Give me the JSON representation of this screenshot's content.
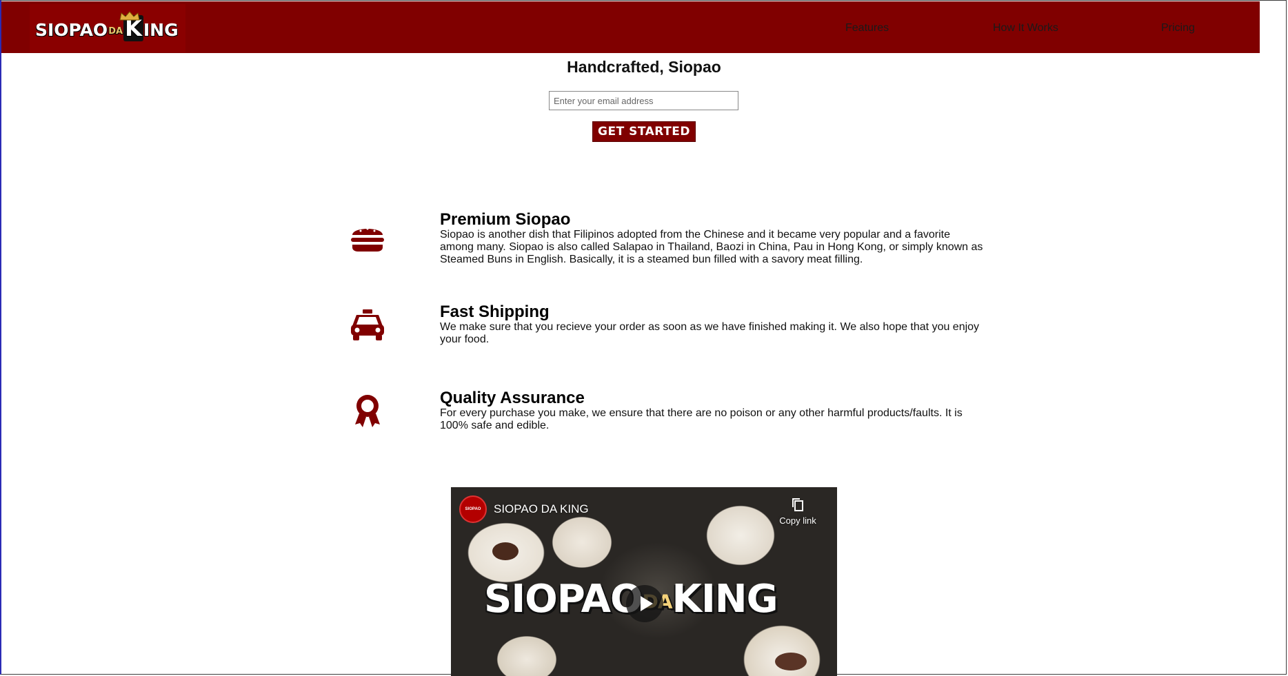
{
  "brand": {
    "logo_main": "SIOPAO",
    "logo_da": "DA",
    "logo_k": "K",
    "logo_end": "ING",
    "primary_color": "#800000"
  },
  "nav": {
    "links": [
      "Features",
      "How It Works",
      "Pricing"
    ]
  },
  "hero": {
    "title": "Handcrafted, Siopao",
    "email_placeholder": "Enter your email address",
    "cta_label": "GET STARTED"
  },
  "features": [
    {
      "icon": "hamburger-icon",
      "title": "Premium Siopao",
      "text": "Siopao is another dish that Filipinos adopted from the Chinese and it became very popular and a favorite among many. Siopao is also called Salapao in Thailand, Baozi in China, Pau in Hong Kong, or simply known as Steamed Buns in English. Basically, it is a steamed bun filled with a savory meat filling."
    },
    {
      "icon": "taxi-icon",
      "title": "Fast Shipping",
      "text": "We make sure that you recieve your order as soon as we have finished making it. We also hope that you enjoy your food."
    },
    {
      "icon": "award-ribbon-icon",
      "title": "Quality Assurance",
      "text": "For every purchase you make, we ensure that there are no poison or any other harmful products/faults. It is 100% safe and edible."
    }
  ],
  "video": {
    "channel_title": "SIOPAO DA KING",
    "copy_link_label": "Copy link",
    "wordmark_main": "SIOPAO",
    "wordmark_da": "DA",
    "wordmark_end": "KING"
  }
}
